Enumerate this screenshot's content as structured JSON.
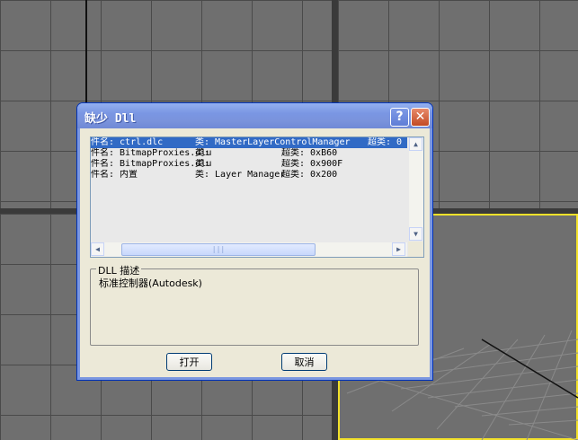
{
  "dialog": {
    "title": "缺少 Dll",
    "help_label": "?",
    "close_label": "✕"
  },
  "file_list": {
    "rows": [
      {
        "file": "件名: ctrl.dlc",
        "class": "类: MasterLayerControlManager",
        "superclass": "超类: 0",
        "selected": true
      },
      {
        "file": "件名: BitmapProxies.dlu",
        "class": "类:",
        "superclass": "超类: 0xB60",
        "selected": false
      },
      {
        "file": "件名: BitmapProxies.dlu",
        "class": "类:",
        "superclass": "超类: 0x900F",
        "selected": false
      },
      {
        "file": "件名:  内置",
        "class": "类: Layer Manager",
        "superclass": "超类: 0x200",
        "selected": false
      }
    ],
    "scroll_up": "▲",
    "scroll_down": "▼",
    "scroll_left": "◀",
    "scroll_right": "▶",
    "hthumb_grip": "|||"
  },
  "description": {
    "legend": "DLL 描述",
    "text": "标准控制器(Autodesk)"
  },
  "buttons": {
    "open": "打开",
    "cancel": "取消"
  },
  "colors": {
    "selection": "#316ac5",
    "active_viewport": "#f2e12a",
    "title_bar": "#7a96e3"
  }
}
